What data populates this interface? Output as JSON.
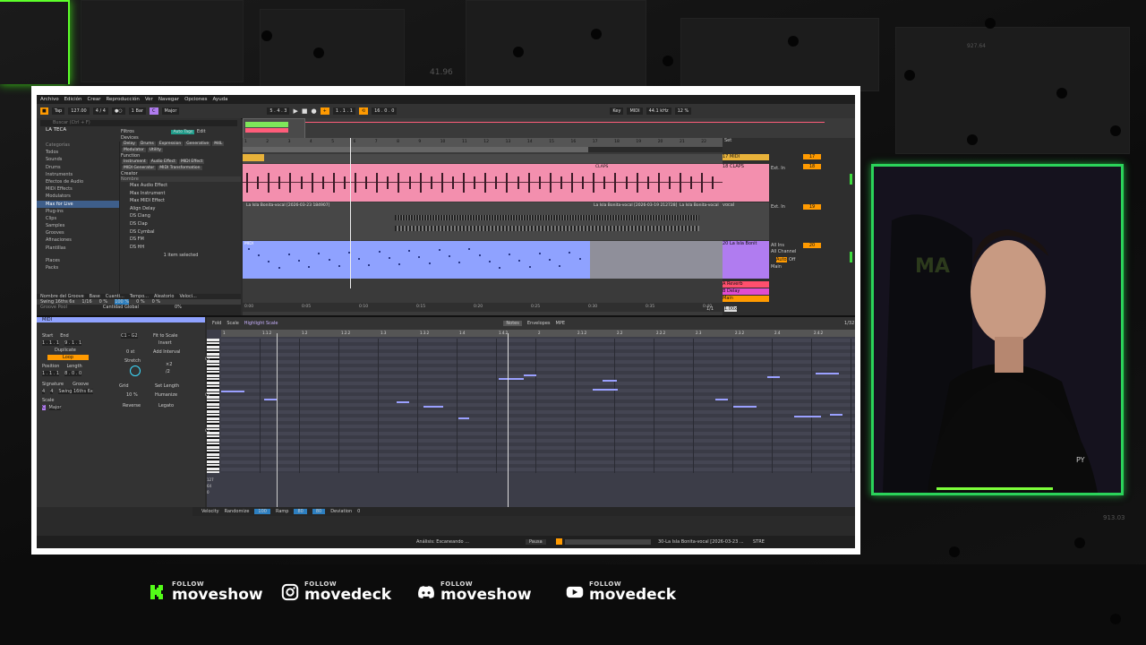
{
  "background": {
    "numbers": [
      "41.96",
      "927.64",
      "913.03"
    ]
  },
  "ableton": {
    "menu": [
      "Archivo",
      "Edición",
      "Crear",
      "Reproducción",
      "Ver",
      "Navegar",
      "Opciones",
      "Ayuda"
    ],
    "transport": {
      "tap": "Tap",
      "tempo": "127.00",
      "signature": "4 / 4",
      "quantize": "1 Bar",
      "key": "C",
      "scale": "Major",
      "position": "5 . 4 . 3",
      "loop_start": "1 . 1 . 1",
      "loop_len": "16 . 0 . 0",
      "key_btn": "Key",
      "midi_btn": "MIDI",
      "sample_rate": "44.1 kHz",
      "cpu": "12 %"
    },
    "browser": {
      "search_placeholder": "Buscar (Ctrl + F)",
      "library": "LA TECA",
      "categories_header": "Categorías",
      "categories": [
        "Todos",
        "Sounds",
        "Drums",
        "Instruments",
        "Efectos de Audio",
        "MIDI Effects",
        "Modulators",
        "Max for Live",
        "Plug-ins",
        "Clips",
        "Samples",
        "Grooves",
        "Afinaciones",
        "Plantillas"
      ],
      "places": [
        "Places",
        "Packs"
      ],
      "filters_label": "Filtros",
      "auto_tags": "Auto Tags",
      "edit": "Edit",
      "devices_label": "Devices",
      "device_tags": [
        "Delay",
        "Drums",
        "Expression",
        "Generative",
        "M4L",
        "Modulator",
        "Utility"
      ],
      "function_label": "Function",
      "function_tags": [
        "Instrument",
        "Audio Effect",
        "MIDI Effect",
        "MIDI Generator",
        "MIDI Transformation"
      ],
      "creator_label": "Creator",
      "name_label": "Nombre",
      "items": [
        "Max Audio Effect",
        "Max Instrument",
        "Max MIDI Effect",
        "Align Delay",
        "DS Clang",
        "DS Clap",
        "DS Cymbal",
        "DS FM",
        "DS HH"
      ],
      "selected_count": "1 item selected"
    },
    "groove": {
      "header": [
        "Nombre del Groove",
        "Base",
        "Cuanti...",
        "Tempo...",
        "Aleatorio",
        "Veloci..."
      ],
      "row": [
        "Swing 16ths 6x",
        "1/16",
        "0 %",
        "100 %",
        "0 %",
        "0 %"
      ],
      "pool_label": "Groove Pool",
      "global_label": "Cantidad Global",
      "global_value": "0%"
    },
    "arrangement": {
      "bars": [
        "1",
        "2",
        "3",
        "4",
        "5",
        "6",
        "7",
        "8",
        "9",
        "10",
        "11",
        "12",
        "13",
        "14",
        "15",
        "16",
        "17",
        "18",
        "19",
        "20",
        "21",
        "22",
        "23"
      ],
      "times": [
        "0:00",
        "0:05",
        "0:10",
        "0:15",
        "0:20",
        "0:25",
        "0:30",
        "0:35",
        "0:40"
      ],
      "clips": {
        "claps": "CLAPS",
        "vocal": "La Isla Bonita-vocal [2026-03-23 184907]",
        "vocal2": "La Isla Bonita-vocal [2026-03-19 212728]",
        "vocal3": "La Isla Bonita-vocal",
        "midi": "MIDI"
      },
      "tracks": [
        "17 MIDI",
        "18 CLAPS",
        "vocal",
        "20 La Isla Bonit",
        "A Reverb",
        "B Delay",
        "Main"
      ],
      "inputs": [
        "Ext. In",
        "Ext. In",
        "All Ins",
        "All Channel"
      ],
      "io": [
        "Auto",
        "Off",
        "Main"
      ],
      "set_label": "Set",
      "track_nums": [
        "17",
        "18",
        "19",
        "20"
      ],
      "zoom": "1.00x",
      "page": "1/1"
    },
    "clip": {
      "title": "MIDI",
      "start": "Start",
      "end": "End",
      "start_val": "1 . 1 . 1",
      "end_val": "9 . 1 . 1",
      "range": "C1 - G2",
      "duplicate": "Duplicate",
      "fit": "Fit to Scale",
      "invert": "Invert",
      "loop": "Loop",
      "position": "Position",
      "length": "Length",
      "pos_val": "1 . 1 . 1",
      "len_val": "8 . 0 . 0",
      "signature": "Signature",
      "sig_a": "4",
      "sig_b": "4",
      "groove": "Groove",
      "groove_val": "Swing 16ths 6x",
      "scale_label": "Scale",
      "scale_key": "C",
      "scale_type": "Major",
      "add_interval": "Add Interval",
      "zero_st": "0 st",
      "stretch": "Stretch",
      "times2": "×2",
      "div2": "/2",
      "grid": "Grid",
      "set_length": "Set Length",
      "humanize": "Humanize",
      "pct": "10 %",
      "reverse": "Reverse",
      "legato": "Legato"
    },
    "piano": {
      "fold": "Fold",
      "scale": "Scale",
      "highlight": "Highlight Scale",
      "tabs": [
        "Notes",
        "Envelopes",
        "MPE"
      ],
      "quant": "1/32",
      "bars": [
        "1",
        "1.1.2",
        "1.2",
        "1.2.2",
        "1.3",
        "1.3.2",
        "1.4",
        "1.4.2",
        "2",
        "2.1.2",
        "2.2",
        "2.2.2",
        "2.3",
        "2.3.2",
        "2.4",
        "2.4.2"
      ],
      "octaves": [
        "C3",
        "C2",
        "C1"
      ],
      "vel_scale": [
        "127",
        "64",
        "0"
      ]
    },
    "velocity": {
      "label": "Velocity",
      "randomize": "Randomize",
      "rand_val": "100",
      "ramp": "Ramp",
      "ramp_a": "80",
      "ramp_b": "80",
      "deviation": "Deviation",
      "dev_val": "0"
    },
    "status": {
      "analysis": "Análisis: Escaneando ...",
      "pause": "Pausa",
      "clip": "30-La Isla Bonita-vocal [2026-03-23 ...",
      "strat": "STRE"
    }
  },
  "social": [
    {
      "follow": "FOLLOW",
      "handle": "moveshow",
      "icon": "kick-icon"
    },
    {
      "follow": "FOLLOW",
      "handle": "movedeck",
      "icon": "instagram-icon"
    },
    {
      "follow": "FOLLOW",
      "handle": "moveshow",
      "icon": "discord-icon"
    },
    {
      "follow": "FOLLOW",
      "handle": "movedeck",
      "icon": "youtube-icon"
    }
  ]
}
